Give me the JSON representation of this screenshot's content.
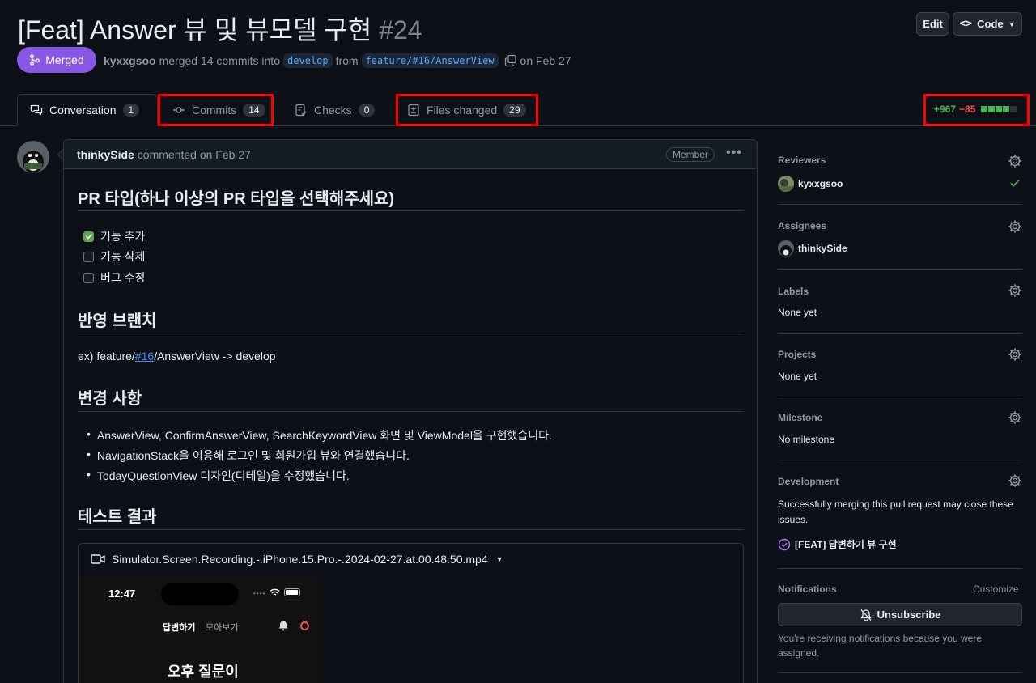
{
  "header": {
    "title": "[Feat] Answer 뷰 및 뷰모델 구현",
    "number": "#24",
    "edit_label": "Edit",
    "code_label": "Code",
    "status_label": "Merged",
    "author": "kyxxgsoo",
    "merged_text": "merged 14 commits into",
    "base_branch": "develop",
    "from_text": "from",
    "head_branch": "feature/#16/AnswerView",
    "date_text": "on Feb 27"
  },
  "tabs": [
    {
      "label": "Conversation",
      "count": "1"
    },
    {
      "label": "Commits",
      "count": "14"
    },
    {
      "label": "Checks",
      "count": "0"
    },
    {
      "label": "Files changed",
      "count": "29"
    }
  ],
  "diffstat": {
    "additions": "+967",
    "deletions": "−85",
    "colors": [
      "#3fb950",
      "#3fb950",
      "#3fb950",
      "#3fb950",
      "#2d333b"
    ]
  },
  "comment": {
    "author": "thinkySide",
    "action": "commented on Feb 27",
    "role": "Member",
    "h_type": "PR 타입(하나 이상의 PR 타입을 선택해주세요)",
    "checks": [
      {
        "label": "기능 추가",
        "checked": true
      },
      {
        "label": "기능 삭제",
        "checked": false
      },
      {
        "label": "버그 수정",
        "checked": false
      }
    ],
    "h_branch": "반영 브랜치",
    "branch_prefix": "ex) feature/",
    "branch_link": "#16",
    "branch_suffix": "/AnswerView -> develop",
    "h_changes": "변경 사항",
    "changes": [
      "AnswerView, ConfirmAnswerView, SearchKeywordView 화면 및 ViewModel을 구현했습니다.",
      "NavigationStack을 이용해 로그인 및 회원가입 뷰와 연결했습니다.",
      "TodayQuestionView 디자인(디테일)을 수정했습니다."
    ],
    "h_test": "테스트 결과",
    "video_name": "Simulator.Screen.Recording.-.iPhone.15.Pro.-.2024-02-27.at.00.48.50.mp4",
    "phone": {
      "time": "12:47",
      "tab1": "답변하기",
      "tab2": "모아보기",
      "heading": "오후 질문이"
    }
  },
  "sidebar": {
    "reviewers_label": "Reviewers",
    "reviewer": "kyxxgsoo",
    "assignees_label": "Assignees",
    "assignee": "thinkySide",
    "labels_label": "Labels",
    "labels_value": "None yet",
    "projects_label": "Projects",
    "projects_value": "None yet",
    "milestone_label": "Milestone",
    "milestone_value": "No milestone",
    "development_label": "Development",
    "development_text": "Successfully merging this pull request may close these issues.",
    "issue": "[FEAT] 답변하기 뷰 구현",
    "notifications_label": "Notifications",
    "customize_label": "Customize",
    "unsubscribe_label": "Unsubscribe",
    "notif_text": "You're receiving notifications because you were assigned."
  }
}
